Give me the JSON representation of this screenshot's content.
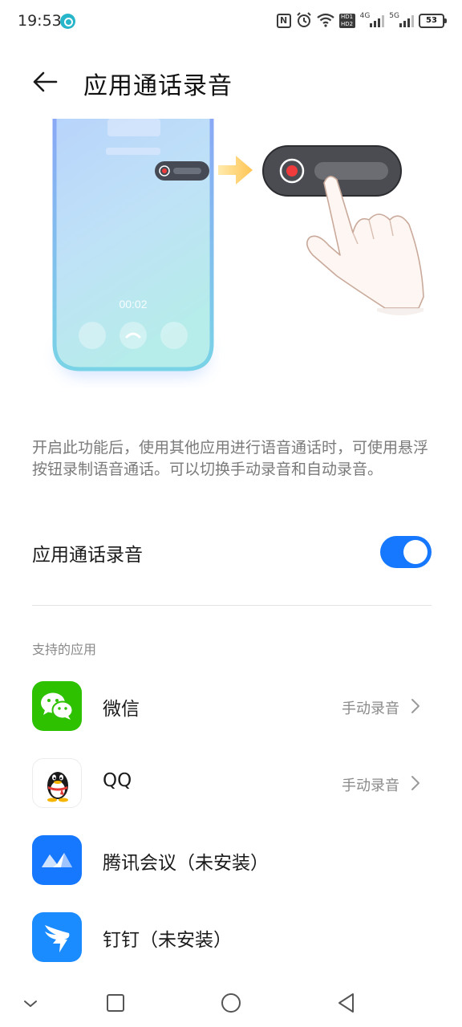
{
  "status_bar": {
    "time": "19:53",
    "hd_label": "HD1\nHD2",
    "network_1": "4G",
    "network_2": "5G",
    "battery": "53"
  },
  "header": {
    "title": "应用通话录音"
  },
  "illustration": {
    "call_timer": "00:02"
  },
  "description": "开启此功能后，使用其他应用进行语音通话时，可使用悬浮按钮录制语音通话。可以切换手动录音和自动录音。",
  "toggle": {
    "label": "应用通话录音",
    "enabled": true
  },
  "section_header": "支持的应用",
  "apps": [
    {
      "name": "微信",
      "status": "手动录音",
      "icon": "wechat-icon"
    },
    {
      "name": "QQ",
      "status": "手动录音",
      "icon": "qq-icon"
    },
    {
      "name": "腾讯会议（未安装）",
      "status": "",
      "icon": "tencent-meeting-icon"
    },
    {
      "name": "钉钉（未安装）",
      "status": "",
      "icon": "dingtalk-icon"
    }
  ],
  "colors": {
    "accent": "#1677ff",
    "wechat": "#2dc100",
    "tencent_meeting": "#1677ff",
    "dingtalk": "#1a8cff"
  }
}
